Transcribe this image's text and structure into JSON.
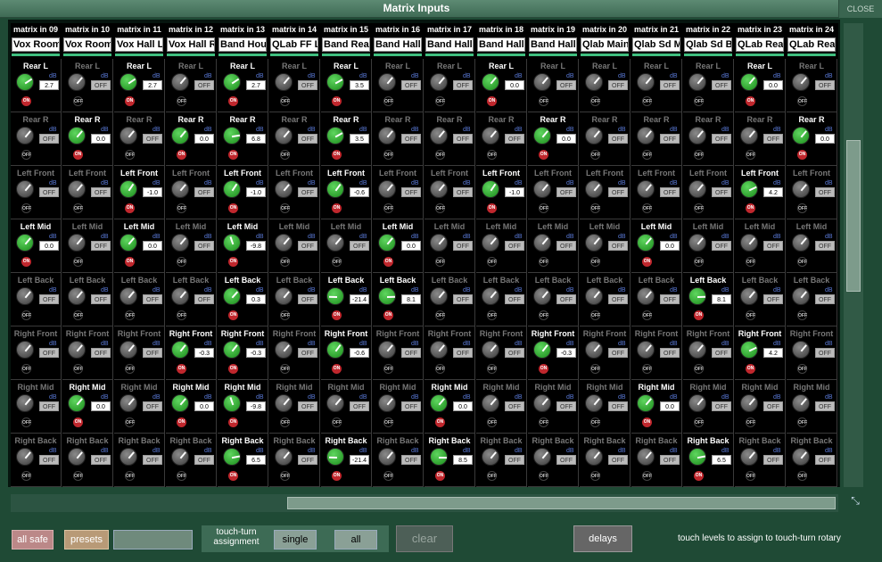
{
  "window": {
    "title": "Matrix Inputs",
    "close_label": "CLOSE"
  },
  "row_labels": [
    "Rear L",
    "Rear R",
    "Left Front",
    "Left Mid",
    "Left Back",
    "Right Front",
    "Right Mid",
    "Right Back"
  ],
  "unit_label": "dB",
  "on_label": "ON",
  "off_label": "OFF",
  "columns": [
    {
      "header": "matrix in 09",
      "name": "Vox Room",
      "cells": [
        {
          "on": true,
          "value": "2.7"
        },
        {
          "on": false,
          "value": "OFF"
        },
        {
          "on": false,
          "value": "OFF"
        },
        {
          "on": true,
          "value": "0.0"
        },
        {
          "on": false,
          "value": "OFF"
        },
        {
          "on": false,
          "value": "OFF"
        },
        {
          "on": false,
          "value": "OFF"
        },
        {
          "on": false,
          "value": "OFF"
        }
      ]
    },
    {
      "header": "matrix in 10",
      "name": "Vox Room",
      "cells": [
        {
          "on": false,
          "value": "OFF"
        },
        {
          "on": true,
          "value": "0.0"
        },
        {
          "on": false,
          "value": "OFF"
        },
        {
          "on": false,
          "value": "OFF"
        },
        {
          "on": false,
          "value": "OFF"
        },
        {
          "on": false,
          "value": "OFF"
        },
        {
          "on": true,
          "value": "0.0"
        },
        {
          "on": false,
          "value": "OFF"
        }
      ]
    },
    {
      "header": "matrix in 11",
      "name": "Vox Hall L",
      "cells": [
        {
          "on": true,
          "value": "2.7"
        },
        {
          "on": false,
          "value": "OFF"
        },
        {
          "on": true,
          "value": "-1.0"
        },
        {
          "on": true,
          "value": "0.0"
        },
        {
          "on": false,
          "value": "OFF"
        },
        {
          "on": false,
          "value": "OFF"
        },
        {
          "on": false,
          "value": "OFF"
        },
        {
          "on": false,
          "value": "OFF"
        }
      ]
    },
    {
      "header": "matrix in 12",
      "name": "Vox Hall R",
      "cells": [
        {
          "on": false,
          "value": "OFF"
        },
        {
          "on": true,
          "value": "0.0"
        },
        {
          "on": false,
          "value": "OFF"
        },
        {
          "on": false,
          "value": "OFF"
        },
        {
          "on": false,
          "value": "OFF"
        },
        {
          "on": true,
          "value": "-0.3"
        },
        {
          "on": true,
          "value": "0.0"
        },
        {
          "on": false,
          "value": "OFF"
        }
      ]
    },
    {
      "header": "matrix in 13",
      "name": "Band House",
      "cells": [
        {
          "on": true,
          "value": "2.7"
        },
        {
          "on": true,
          "value": "6.8"
        },
        {
          "on": true,
          "value": "-1.0"
        },
        {
          "on": true,
          "value": "-9.8"
        },
        {
          "on": true,
          "value": "0.3"
        },
        {
          "on": true,
          "value": "-0.3"
        },
        {
          "on": true,
          "value": "-9.8"
        },
        {
          "on": true,
          "value": "6.5"
        }
      ]
    },
    {
      "header": "matrix in 14",
      "name": "QLab FF L",
      "cells": [
        {
          "on": false,
          "value": "OFF"
        },
        {
          "on": false,
          "value": "OFF"
        },
        {
          "on": false,
          "value": "OFF"
        },
        {
          "on": false,
          "value": "OFF"
        },
        {
          "on": false,
          "value": "OFF"
        },
        {
          "on": false,
          "value": "OFF"
        },
        {
          "on": false,
          "value": "OFF"
        },
        {
          "on": false,
          "value": "OFF"
        }
      ]
    },
    {
      "header": "matrix in 15",
      "name": "Band Rear",
      "cells": [
        {
          "on": true,
          "value": "3.5"
        },
        {
          "on": true,
          "value": "3.5"
        },
        {
          "on": true,
          "value": "-0.6"
        },
        {
          "on": false,
          "value": "OFF"
        },
        {
          "on": true,
          "value": "-21.4"
        },
        {
          "on": true,
          "value": "-0.6"
        },
        {
          "on": false,
          "value": "OFF"
        },
        {
          "on": true,
          "value": "-21.4"
        }
      ]
    },
    {
      "header": "matrix in 16",
      "name": "Band Hall",
      "cells": [
        {
          "on": false,
          "value": "OFF"
        },
        {
          "on": false,
          "value": "OFF"
        },
        {
          "on": false,
          "value": "OFF"
        },
        {
          "on": true,
          "value": "0.0"
        },
        {
          "on": true,
          "value": "8.1"
        },
        {
          "on": false,
          "value": "OFF"
        },
        {
          "on": false,
          "value": "OFF"
        },
        {
          "on": false,
          "value": "OFF"
        }
      ]
    },
    {
      "header": "matrix in 17",
      "name": "Band Hall",
      "cells": [
        {
          "on": false,
          "value": "OFF"
        },
        {
          "on": false,
          "value": "OFF"
        },
        {
          "on": false,
          "value": "OFF"
        },
        {
          "on": false,
          "value": "OFF"
        },
        {
          "on": false,
          "value": "OFF"
        },
        {
          "on": false,
          "value": "OFF"
        },
        {
          "on": true,
          "value": "0.0"
        },
        {
          "on": true,
          "value": "8.5"
        }
      ]
    },
    {
      "header": "matrix in 18",
      "name": "Band Hall",
      "cells": [
        {
          "on": true,
          "value": "0.0"
        },
        {
          "on": false,
          "value": "OFF"
        },
        {
          "on": true,
          "value": "-1.0"
        },
        {
          "on": false,
          "value": "OFF"
        },
        {
          "on": false,
          "value": "OFF"
        },
        {
          "on": false,
          "value": "OFF"
        },
        {
          "on": false,
          "value": "OFF"
        },
        {
          "on": false,
          "value": "OFF"
        }
      ]
    },
    {
      "header": "matrix in 19",
      "name": "Band Hall",
      "cells": [
        {
          "on": false,
          "value": "OFF"
        },
        {
          "on": true,
          "value": "0.0"
        },
        {
          "on": false,
          "value": "OFF"
        },
        {
          "on": false,
          "value": "OFF"
        },
        {
          "on": false,
          "value": "OFF"
        },
        {
          "on": true,
          "value": "-0.3"
        },
        {
          "on": false,
          "value": "OFF"
        },
        {
          "on": false,
          "value": "OFF"
        }
      ]
    },
    {
      "header": "matrix in 20",
      "name": "Qlab Main",
      "cells": [
        {
          "on": false,
          "value": "OFF"
        },
        {
          "on": false,
          "value": "OFF"
        },
        {
          "on": false,
          "value": "OFF"
        },
        {
          "on": false,
          "value": "OFF"
        },
        {
          "on": false,
          "value": "OFF"
        },
        {
          "on": false,
          "value": "OFF"
        },
        {
          "on": false,
          "value": "OFF"
        },
        {
          "on": false,
          "value": "OFF"
        }
      ]
    },
    {
      "header": "matrix in 21",
      "name": "Qlab Sd M",
      "cells": [
        {
          "on": false,
          "value": "OFF"
        },
        {
          "on": false,
          "value": "OFF"
        },
        {
          "on": false,
          "value": "OFF"
        },
        {
          "on": true,
          "value": "0.0"
        },
        {
          "on": false,
          "value": "OFF"
        },
        {
          "on": false,
          "value": "OFF"
        },
        {
          "on": true,
          "value": "0.0"
        },
        {
          "on": false,
          "value": "OFF"
        }
      ]
    },
    {
      "header": "matrix in 22",
      "name": "Qlab Sd B",
      "cells": [
        {
          "on": false,
          "value": "OFF"
        },
        {
          "on": false,
          "value": "OFF"
        },
        {
          "on": false,
          "value": "OFF"
        },
        {
          "on": false,
          "value": "OFF"
        },
        {
          "on": true,
          "value": "8.1"
        },
        {
          "on": false,
          "value": "OFF"
        },
        {
          "on": false,
          "value": "OFF"
        },
        {
          "on": true,
          "value": "6.5"
        }
      ]
    },
    {
      "header": "matrix in 23",
      "name": "QLab Rear",
      "cells": [
        {
          "on": true,
          "value": "0.0"
        },
        {
          "on": false,
          "value": "OFF"
        },
        {
          "on": true,
          "value": "4.2"
        },
        {
          "on": false,
          "value": "OFF"
        },
        {
          "on": false,
          "value": "OFF"
        },
        {
          "on": true,
          "value": "4.2"
        },
        {
          "on": false,
          "value": "OFF"
        },
        {
          "on": false,
          "value": "OFF"
        }
      ]
    },
    {
      "header": "matrix in 24",
      "name": "QLab Rear",
      "cells": [
        {
          "on": false,
          "value": "OFF"
        },
        {
          "on": true,
          "value": "0.0"
        },
        {
          "on": false,
          "value": "OFF"
        },
        {
          "on": false,
          "value": "OFF"
        },
        {
          "on": false,
          "value": "OFF"
        },
        {
          "on": false,
          "value": "OFF"
        },
        {
          "on": false,
          "value": "OFF"
        },
        {
          "on": false,
          "value": "OFF"
        }
      ]
    }
  ],
  "footer": {
    "all_safe": "all safe",
    "presets": "presets",
    "touch_turn_line1": "touch-turn",
    "touch_turn_line2": "assignment",
    "single": "single",
    "all": "all",
    "clear": "clear",
    "delays": "delays",
    "hint": "touch levels to assign to touch-turn rotary"
  }
}
